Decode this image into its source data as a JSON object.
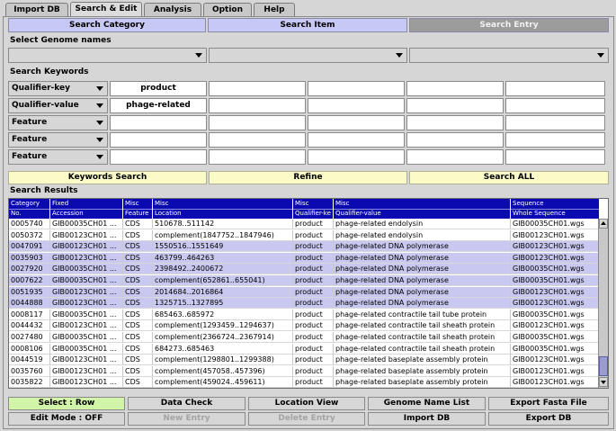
{
  "tabs": [
    {
      "label": "Import DB",
      "active": false
    },
    {
      "label": "Search & Edit",
      "active": true
    },
    {
      "label": "Analysis",
      "active": false
    },
    {
      "label": "Option",
      "active": false
    },
    {
      "label": "Help",
      "active": false
    }
  ],
  "modes": {
    "category": "Search Category",
    "item": "Search Item",
    "entry": "Search Entry"
  },
  "genome": {
    "label": "Select Genome names"
  },
  "keywords": {
    "label": "Search Keywords",
    "rows": [
      {
        "type": "Qualifier-key",
        "value": "product"
      },
      {
        "type": "Qualifier-value",
        "value": "phage-related"
      },
      {
        "type": "Feature",
        "value": ""
      },
      {
        "type": "Feature",
        "value": ""
      },
      {
        "type": "Feature",
        "value": ""
      }
    ]
  },
  "actions": {
    "keywords_search": "Keywords Search",
    "refine": "Refine",
    "search_all": "Search ALL"
  },
  "results": {
    "label": "Search Results",
    "columns": [
      {
        "top": "Category",
        "bottom": "No."
      },
      {
        "top": "Fixed",
        "bottom": "Accession"
      },
      {
        "top": "Misc",
        "bottom": "Feature"
      },
      {
        "top": "Misc",
        "bottom": "Location"
      },
      {
        "top": "Misc",
        "bottom": "Qualifier-ke"
      },
      {
        "top": "Misc",
        "bottom": "Qualifier-value"
      },
      {
        "top": "Sequence",
        "bottom": "Whole Sequence"
      }
    ],
    "rows": [
      {
        "no": "0005740",
        "acc": "GIB00035CH01 ...",
        "feature": "CDS",
        "loc": "510678..511142",
        "qkey": "product",
        "qval": "phage-related endolysin",
        "seq": "GIB00035CH01.wgs",
        "sel": false
      },
      {
        "no": "0050372",
        "acc": "GIB00123CH01 ...",
        "feature": "CDS",
        "loc": "complement(1847752..1847946)",
        "qkey": "product",
        "qval": "phage-related endolysin",
        "seq": "GIB00123CH01.wgs",
        "sel": false
      },
      {
        "no": "0047091",
        "acc": "GIB00123CH01 ...",
        "feature": "CDS",
        "loc": "1550516..1551649",
        "qkey": "product",
        "qval": "phage-related DNA polymerase",
        "seq": "GIB00123CH01.wgs",
        "sel": true
      },
      {
        "no": "0035903",
        "acc": "GIB00123CH01 ...",
        "feature": "CDS",
        "loc": "463799..464263",
        "qkey": "product",
        "qval": "phage-related DNA polymerase",
        "seq": "GIB00123CH01.wgs",
        "sel": true
      },
      {
        "no": "0027920",
        "acc": "GIB00035CH01 ...",
        "feature": "CDS",
        "loc": "2398492..2400672",
        "qkey": "product",
        "qval": "phage-related DNA polymerase",
        "seq": "GIB00035CH01.wgs",
        "sel": true
      },
      {
        "no": "0007622",
        "acc": "GIB00035CH01 ...",
        "feature": "CDS",
        "loc": "complement(652861..655041)",
        "qkey": "product",
        "qval": "phage-related DNA polymerase",
        "seq": "GIB00035CH01.wgs",
        "sel": true
      },
      {
        "no": "0051935",
        "acc": "GIB00123CH01 ...",
        "feature": "CDS",
        "loc": "2014684..2016864",
        "qkey": "product",
        "qval": "phage-related DNA polymerase",
        "seq": "GIB00123CH01.wgs",
        "sel": true
      },
      {
        "no": "0044888",
        "acc": "GIB00123CH01 ...",
        "feature": "CDS",
        "loc": "1325715..1327895",
        "qkey": "product",
        "qval": "phage-related DNA polymerase",
        "seq": "GIB00123CH01.wgs",
        "sel": true
      },
      {
        "no": "0008117",
        "acc": "GIB00035CH01 ...",
        "feature": "CDS",
        "loc": "685463..685972",
        "qkey": "product",
        "qval": "phage-related contractile tail tube protein",
        "seq": "GIB00035CH01.wgs",
        "sel": false
      },
      {
        "no": "0044432",
        "acc": "GIB00123CH01 ...",
        "feature": "CDS",
        "loc": "complement(1293459..1294637)",
        "qkey": "product",
        "qval": "phage-related contractile tail sheath protein",
        "seq": "GIB00123CH01.wgs",
        "sel": false
      },
      {
        "no": "0027480",
        "acc": "GIB00035CH01 ...",
        "feature": "CDS",
        "loc": "complement(2366724..2367914)",
        "qkey": "product",
        "qval": "phage-related contractile tail sheath protein",
        "seq": "GIB00035CH01.wgs",
        "sel": false
      },
      {
        "no": "0008106",
        "acc": "GIB00035CH01 ...",
        "feature": "CDS",
        "loc": "684273..685463",
        "qkey": "product",
        "qval": "phage-related contractile tail sheath protein",
        "seq": "GIB00035CH01.wgs",
        "sel": false
      },
      {
        "no": "0044519",
        "acc": "GIB00123CH01 ...",
        "feature": "CDS",
        "loc": "complement(1298801..1299388)",
        "qkey": "product",
        "qval": "phage-related baseplate assembly protein",
        "seq": "GIB00123CH01.wgs",
        "sel": false
      },
      {
        "no": "0035760",
        "acc": "GIB00123CH01 ...",
        "feature": "CDS",
        "loc": "complement(457058..457396)",
        "qkey": "product",
        "qval": "phage-related baseplate assembly protein",
        "seq": "GIB00123CH01.wgs",
        "sel": false
      },
      {
        "no": "0035822",
        "acc": "GIB00123CH01 ...",
        "feature": "CDS",
        "loc": "complement(459024..459611)",
        "qkey": "product",
        "qval": "phage-related baseplate assembly protein",
        "seq": "GIB00123CH01.wgs",
        "sel": false
      }
    ]
  },
  "bottom": {
    "row1": [
      {
        "label": "Select : Row",
        "style": "green"
      },
      {
        "label": "Data Check",
        "style": ""
      },
      {
        "label": "Location View",
        "style": ""
      },
      {
        "label": "Genome Name List",
        "style": ""
      },
      {
        "label": "Export Fasta File",
        "style": ""
      }
    ],
    "row2": [
      {
        "label": "Edit Mode : OFF",
        "style": ""
      },
      {
        "label": "New Entry",
        "style": "disabled"
      },
      {
        "label": "Delete Entry",
        "style": "disabled"
      },
      {
        "label": "Import DB",
        "style": ""
      },
      {
        "label": "Export DB",
        "style": ""
      }
    ]
  },
  "colors": {
    "header_bg": "#0a0ab0",
    "selected_row": "#c8c8f0",
    "yellow_button": "#fbfbc8",
    "green_button": "#d2f4a8",
    "mode_lavender": "#c8c8f4",
    "mode_gray": "#9c9c9c"
  }
}
